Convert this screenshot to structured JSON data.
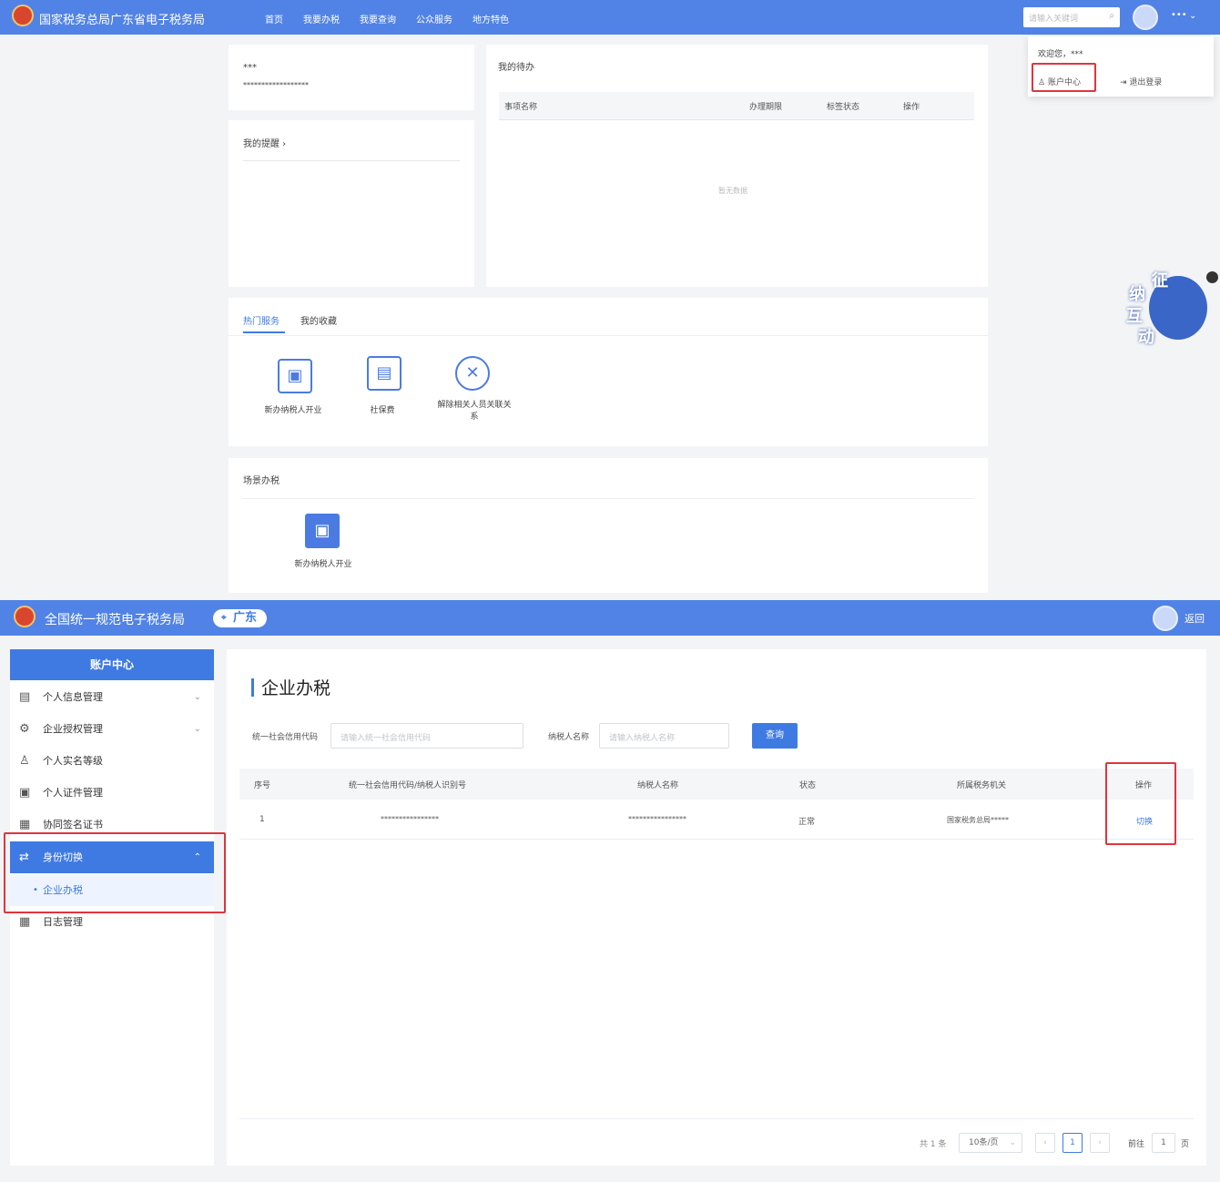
{
  "top": {
    "site_title": "国家税务总局广东省电子税务局",
    "nav": [
      "首页",
      "我要办税",
      "我要查询",
      "公众服务",
      "地方特色"
    ],
    "search_placeholder": "请输入关键词",
    "more": "•••",
    "dropdown": {
      "welcome": "欢迎您，***",
      "account_center": "账户中心",
      "logout": "退出登录"
    },
    "user_card": {
      "name": "***",
      "id": "******************"
    },
    "reminder_title": "我的提醒 ›",
    "todo": {
      "title": "我的待办",
      "columns": [
        "事项名称",
        "办理期限",
        "标签状态",
        "操作"
      ],
      "empty": "暂无数据"
    },
    "services": {
      "tabs": [
        "热门服务",
        "我的收藏"
      ],
      "items": [
        {
          "label": "新办纳税人开业",
          "icon": "new-taxpayer-icon"
        },
        {
          "label": "社保费",
          "icon": "social-security-icon"
        },
        {
          "label": "解除相关人员关联关系",
          "icon": "unlink-icon"
        }
      ]
    },
    "scene": {
      "title": "场景办税",
      "item": "新办纳税人开业"
    },
    "mascot_text": [
      "征",
      "纳",
      "互",
      "动"
    ]
  },
  "bottom": {
    "site_title": "全国统一规范电子税务局",
    "region": "广东",
    "back": "返回",
    "sidebar": {
      "title": "账户中心",
      "items": [
        {
          "label": "个人信息管理",
          "icon": "profile-icon"
        },
        {
          "label": "企业授权管理",
          "icon": "authorize-icon"
        },
        {
          "label": "个人实名等级",
          "icon": "person-icon"
        },
        {
          "label": "个人证件管理",
          "icon": "id-card-icon"
        },
        {
          "label": "协同签名证书",
          "icon": "certificate-icon"
        },
        {
          "label": "身份切换",
          "icon": "switch-icon"
        },
        {
          "label": "企业办税",
          "icon": ""
        },
        {
          "label": "日志管理",
          "icon": "log-icon"
        }
      ]
    },
    "page_title": "企业办税",
    "filters": {
      "credit_code_label": "统一社会信用代码",
      "credit_code_placeholder": "请输入统一社会信用代码",
      "taxpayer_label": "纳税人名称",
      "taxpayer_placeholder": "请输入纳税人名称",
      "query": "查询"
    },
    "table": {
      "columns": [
        "序号",
        "统一社会信用代码/纳税人识别号",
        "纳税人名称",
        "状态",
        "所属税务机关",
        "操作"
      ],
      "rows": [
        [
          "1",
          "****************",
          "****************",
          "正常",
          "国家税务总局*****",
          "切换"
        ]
      ]
    },
    "pagination": {
      "total": "共 1 条",
      "page_size": "10条/页",
      "prev": "‹",
      "current": "1",
      "next": "›",
      "goto": "前往",
      "goto_value": "1",
      "page_unit": "页"
    }
  }
}
